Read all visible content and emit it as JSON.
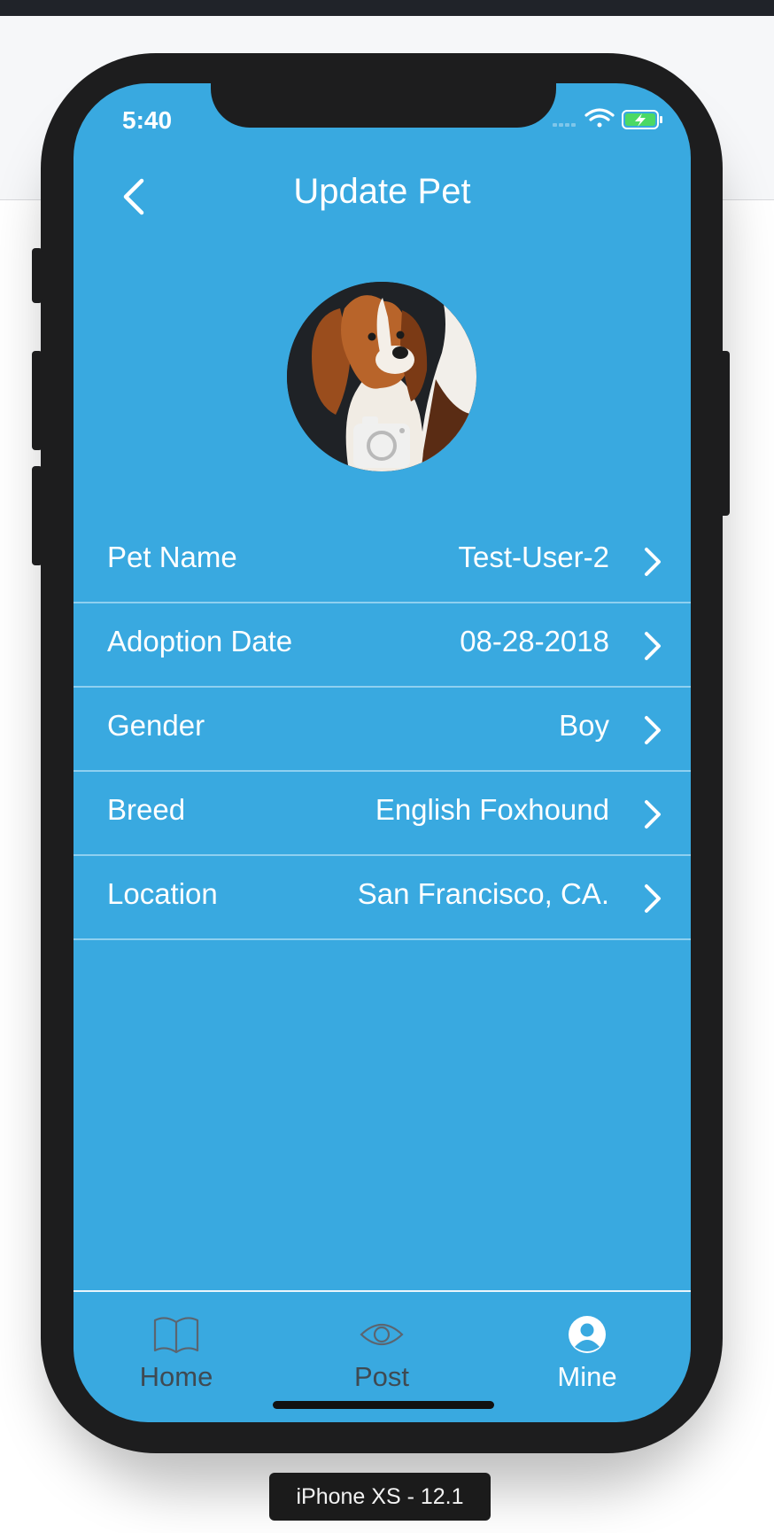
{
  "status": {
    "time": "5:40"
  },
  "nav": {
    "title": "Update Pet"
  },
  "pet_fields": [
    {
      "label": "Pet Name",
      "value": "Test-User-2"
    },
    {
      "label": "Adoption Date",
      "value": "08-28-2018"
    },
    {
      "label": "Gender",
      "value": "Boy"
    },
    {
      "label": "Breed",
      "value": "English Foxhound"
    },
    {
      "label": "Location",
      "value": "San Francisco, CA."
    }
  ],
  "tabbar": {
    "tabs": [
      {
        "label": "Home",
        "icon": "book-icon",
        "active": false
      },
      {
        "label": "Post",
        "icon": "eye-icon",
        "active": false
      },
      {
        "label": "Mine",
        "icon": "user-circle-icon",
        "active": true
      }
    ],
    "active_color": "#ffffff",
    "inactive_color": "#3f4a52"
  },
  "colors": {
    "screen_bg": "#39a9e0",
    "divider": "#8fd0f0"
  },
  "device_label": "iPhone XS - 12.1"
}
